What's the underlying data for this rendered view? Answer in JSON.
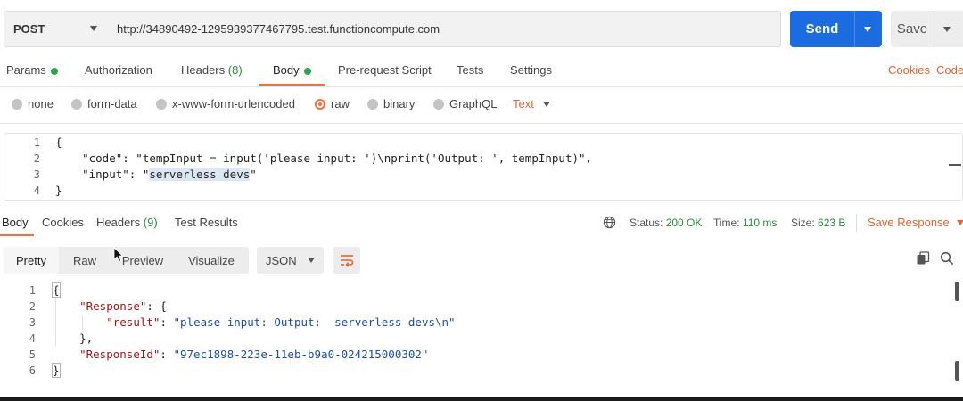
{
  "request": {
    "method": "POST",
    "url": "http://34890492-1295939377467795.test.functioncompute.com",
    "send_label": "Send",
    "save_label": "Save"
  },
  "request_tabs": {
    "params": "Params",
    "authorization": "Authorization",
    "headers": "Headers",
    "headers_count": "(8)",
    "body": "Body",
    "prerequest": "Pre-request Script",
    "tests": "Tests",
    "settings": "Settings",
    "cookies": "Cookies",
    "code": "Code"
  },
  "body_types": {
    "none": "none",
    "form_data": "form-data",
    "urlencoded": "x-www-form-urlencoded",
    "raw": "raw",
    "binary": "binary",
    "graphql": "GraphQL",
    "selected": "raw",
    "format": "Text"
  },
  "request_body": {
    "line_numbers": [
      "1",
      "2",
      "3",
      "4"
    ],
    "line1": "{",
    "line2": "    \"code\": \"tempInput = input('please input: ')\\nprint('Output: ', tempInput)\",",
    "line3_prefix": "    \"input\": \"",
    "line3_highlight": "serverless devs",
    "line3_suffix": "\"",
    "line4": "}"
  },
  "response_tabs": {
    "body": "Body",
    "cookies": "Cookies",
    "headers": "Headers",
    "headers_count": "(9)",
    "test_results": "Test Results"
  },
  "response_status": {
    "status_label": "Status:",
    "status_value": "200 OK",
    "time_label": "Time:",
    "time_value": "110 ms",
    "size_label": "Size:",
    "size_value": "623 B",
    "save_response": "Save Response"
  },
  "view_modes": {
    "pretty": "Pretty",
    "raw": "Raw",
    "preview": "Preview",
    "visualize": "Visualize",
    "active": "Pretty",
    "format": "JSON"
  },
  "response_body": {
    "line_numbers": [
      "1",
      "2",
      "3",
      "4",
      "5",
      "6"
    ],
    "l1": "{",
    "l2_key": "\"Response\"",
    "l2_rest": ": {",
    "l3_key": "\"result\"",
    "l3_colon": ": ",
    "l3_val": "\"please input: Output:  serverless devs\\n\"",
    "l4": "},",
    "l5_key": "\"ResponseId\"",
    "l5_colon": ": ",
    "l5_val": "\"97ec1898-223e-11eb-b9a0-024215000302\"",
    "l6": "}"
  },
  "colors": {
    "accent": "#ff6c37",
    "send_button": "#1a6ce0",
    "status_ok": "#2a8a3e"
  }
}
